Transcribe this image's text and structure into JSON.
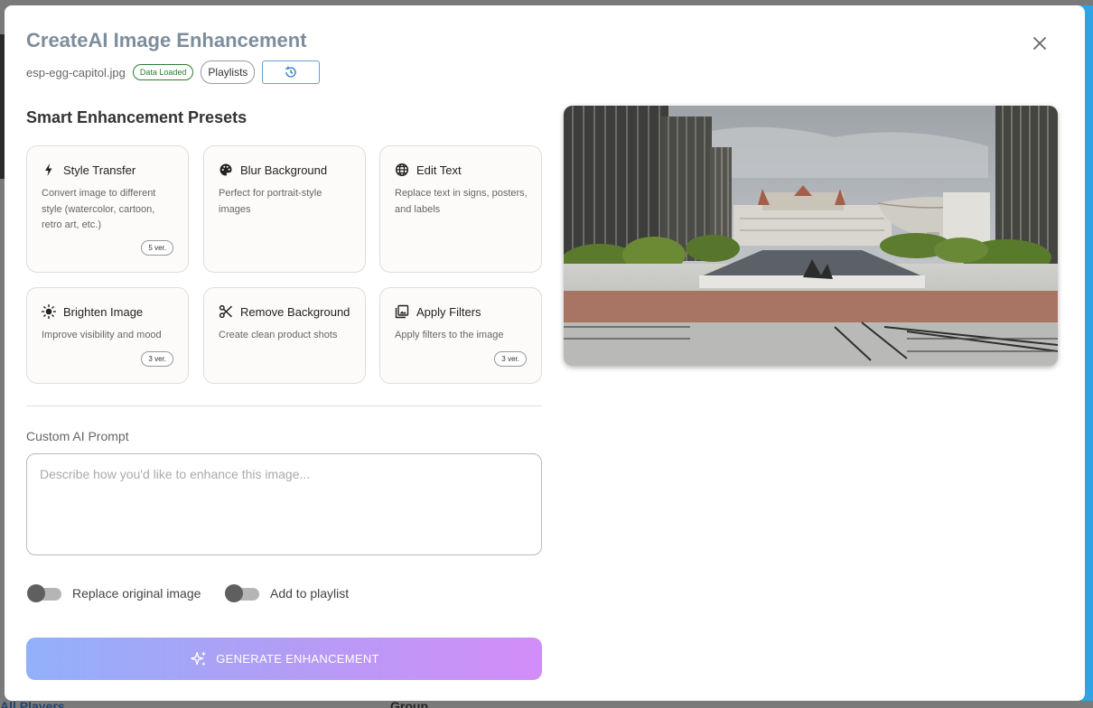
{
  "dialog": {
    "title": "CreateAI Image Enhancement",
    "filename": "esp-egg-capitol.jpg",
    "status_badge": "Data Loaded",
    "playlists_chip": "Playlists",
    "history_icon": "history-icon",
    "close_icon": "close-icon"
  },
  "presets": {
    "heading": "Smart Enhancement Presets",
    "items": [
      {
        "title": "Style Transfer",
        "icon": "bolt-icon",
        "description": "Convert image to different style (watercolor, cartoon, retro art, etc.)",
        "versions": "5 ver."
      },
      {
        "title": "Blur Background",
        "icon": "palette-icon",
        "description": "Perfect for portrait-style images",
        "versions": ""
      },
      {
        "title": "Edit Text",
        "icon": "globe-icon",
        "description": "Replace text in signs, posters, and labels",
        "versions": ""
      },
      {
        "title": "Brighten Image",
        "icon": "sun-icon",
        "description": "Improve visibility and mood",
        "versions": "3 ver."
      },
      {
        "title": "Remove Background",
        "icon": "scissors-icon",
        "description": "Create clean product shots",
        "versions": ""
      },
      {
        "title": "Apply Filters",
        "icon": "image-filter-icon",
        "description": "Apply filters to the image",
        "versions": "3 ver."
      }
    ]
  },
  "custom_prompt": {
    "label": "Custom AI Prompt",
    "placeholder": "Describe how you'd like to enhance this image...",
    "value": ""
  },
  "options": {
    "replace_original": {
      "label": "Replace original image",
      "enabled": false
    },
    "add_to_playlist": {
      "label": "Add to playlist",
      "enabled": false
    }
  },
  "generate_button": {
    "label": "GENERATE ENHANCEMENT",
    "icon": "sparkles-icon"
  },
  "background_page": {
    "players_link": "All Players",
    "group_label": "Group"
  },
  "colors": {
    "title": "#7d8d9b",
    "success": "#2e7d32",
    "gradient_start": "#92b1fb",
    "gradient_end": "#d38df8",
    "accent_bar": "#2ea4e6"
  }
}
